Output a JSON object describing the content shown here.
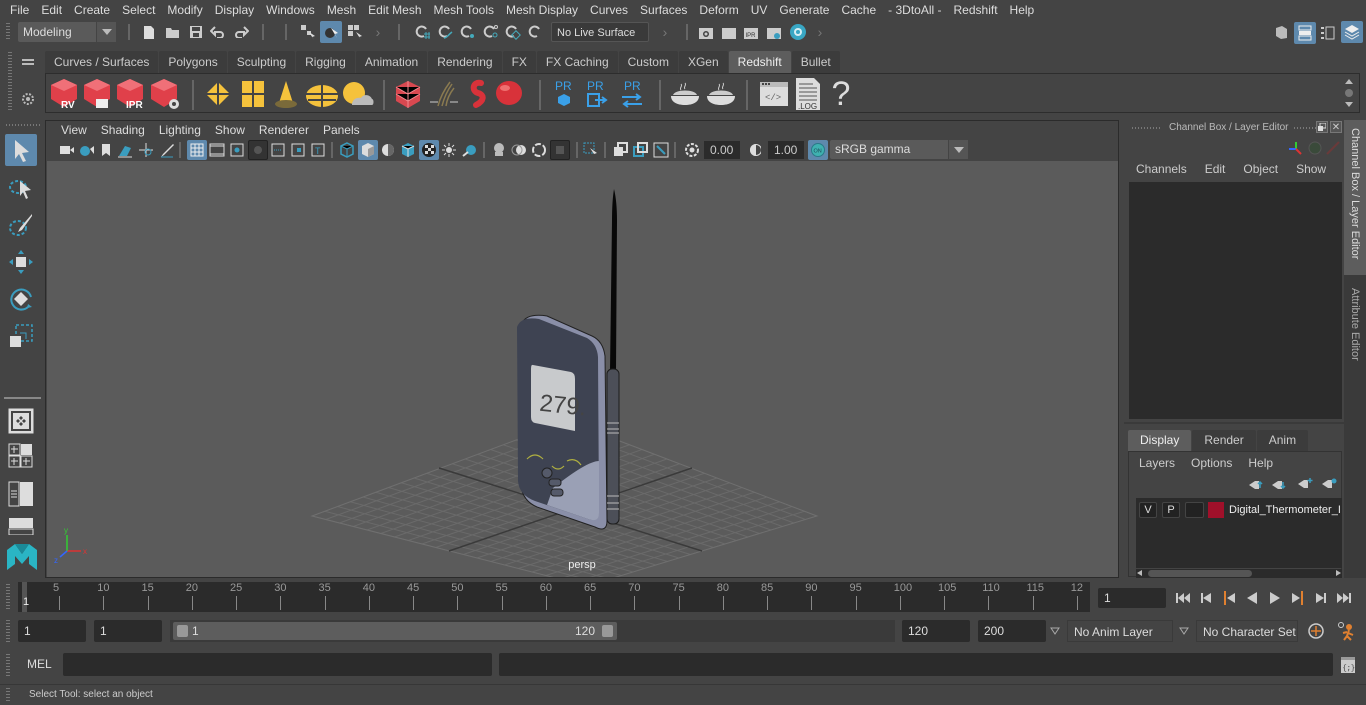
{
  "menubar": {
    "items": [
      "File",
      "Edit",
      "Create",
      "Select",
      "Modify",
      "Display",
      "Windows",
      "Mesh",
      "Edit Mesh",
      "Mesh Tools",
      "Mesh Display",
      "Curves",
      "Surfaces",
      "Deform",
      "UV",
      "Generate",
      "Cache",
      "- 3DtoAll -",
      "Redshift",
      "Help"
    ]
  },
  "statusline": {
    "menuset": "Modeling",
    "live_surface": "No Live Surface",
    "icons": [
      "new-scene-icon",
      "open-scene-icon",
      "save-scene-icon",
      "undo-icon",
      "redo-icon",
      "select-by-hierarchy-icon",
      "select-by-object-icon",
      "select-by-component-icon",
      "snap-grid-icon",
      "snap-curve-icon",
      "snap-point-icon",
      "snap-view-plane-icon",
      "snap-surface-icon",
      "snap-live-icon",
      "render-view-icon",
      "render-frame-icon",
      "ipr-render-icon",
      "render-settings-icon",
      "hypershade-icon"
    ],
    "right_icons": [
      "modeling-toolkit-icon",
      "channel-box-toggle-icon",
      "attribute-editor-toggle-icon",
      "tool-settings-toggle-icon"
    ]
  },
  "shelf": {
    "tabs": [
      "Curves / Surfaces",
      "Polygons",
      "Sculpting",
      "Rigging",
      "Animation",
      "Rendering",
      "FX",
      "FX Caching",
      "Custom",
      "XGen",
      "Redshift",
      "Bullet"
    ],
    "active_tab": "Redshift",
    "buttons": [
      {
        "name": "redshift-rv-icon",
        "label": "RV"
      },
      {
        "name": "redshift-render-icon",
        "label": ""
      },
      {
        "name": "redshift-ipr-icon",
        "label": "IPR"
      },
      {
        "name": "redshift-settings-icon",
        "label": ""
      },
      {
        "name": "area-light-icon",
        "label": ""
      },
      {
        "name": "portal-light-icon",
        "label": ""
      },
      {
        "name": "spot-light-icon",
        "label": ""
      },
      {
        "name": "dome-light-icon",
        "label": ""
      },
      {
        "name": "sun-sky-icon",
        "label": ""
      },
      {
        "name": "proxy-cubes-icon",
        "label": ""
      },
      {
        "name": "hair-icon",
        "label": ""
      },
      {
        "name": "volume-icon",
        "label": ""
      },
      {
        "name": "sphere-material-icon",
        "label": ""
      },
      {
        "name": "pr-proxy-icon",
        "label": "PR"
      },
      {
        "name": "pr-export-icon",
        "label": "PR"
      },
      {
        "name": "pr-swap-icon",
        "label": "PR"
      },
      {
        "name": "bake-pie-1-icon",
        "label": ""
      },
      {
        "name": "bake-pie-2-icon",
        "label": ""
      },
      {
        "name": "script-editor-icon",
        "label": ""
      },
      {
        "name": "log-icon",
        "label": ".LOG"
      },
      {
        "name": "help-icon",
        "label": "?"
      }
    ]
  },
  "viewport": {
    "menus": [
      "View",
      "Shading",
      "Lighting",
      "Show",
      "Renderer",
      "Panels"
    ],
    "exposure": "0.00",
    "gamma": "1.00",
    "color_mgmt_toggle": "ON",
    "color_space": "sRGB gamma",
    "camera_label": "persp",
    "model_display_reading": "279."
  },
  "channel_box": {
    "title": "Channel Box / Layer Editor",
    "menus": [
      "Channels",
      "Edit",
      "Object",
      "Show"
    ],
    "layer_tabs": [
      "Display",
      "Render",
      "Anim"
    ],
    "active_layer_tab": "Display",
    "layer_menus": [
      "Layers",
      "Options",
      "Help"
    ],
    "layers": [
      {
        "visible": "V",
        "playback": "P",
        "type": "",
        "color": "#a0102a",
        "name": "Digital_Thermometer_I"
      }
    ]
  },
  "side_tabs": [
    "Channel Box / Layer Editor",
    "Attribute Editor"
  ],
  "timeline": {
    "ticks": [
      "5",
      "10",
      "15",
      "20",
      "25",
      "30",
      "35",
      "40",
      "45",
      "50",
      "55",
      "60",
      "65",
      "70",
      "75",
      "80",
      "85",
      "90",
      "95",
      "100",
      "105",
      "110",
      "115",
      "12"
    ],
    "current_frame_marker": "1",
    "current_frame": "1"
  },
  "range": {
    "start": "1",
    "anim_start": "1",
    "slider_start": "1",
    "slider_end": "120",
    "anim_end": "120",
    "end": "200",
    "anim_layer": "No Anim Layer",
    "character_set": "No Character Set"
  },
  "cmdline": {
    "label": "MEL"
  },
  "helpline": {
    "text": "Select Tool: select an object"
  }
}
